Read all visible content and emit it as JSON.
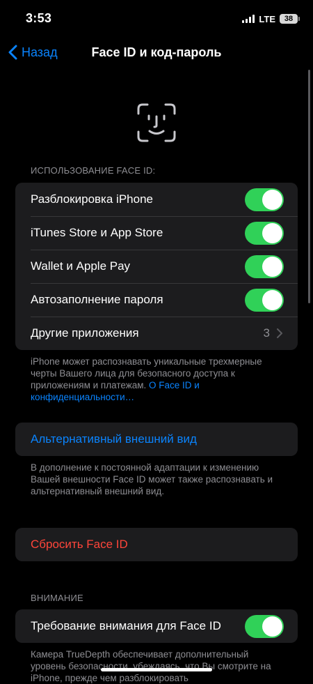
{
  "status": {
    "time": "3:53",
    "network": "LTE",
    "battery": "38"
  },
  "nav": {
    "back_label": "Назад",
    "title": "Face ID и код-пароль"
  },
  "use_faceid": {
    "header": "ИСПОЛЬЗОВАНИЕ FACE ID:",
    "items": [
      {
        "label": "Разблокировка iPhone",
        "on": true
      },
      {
        "label": "iTunes Store и App Store",
        "on": true
      },
      {
        "label": "Wallet и Apple Pay",
        "on": true
      },
      {
        "label": "Автозаполнение пароля",
        "on": true
      }
    ],
    "other_apps": {
      "label": "Другие приложения",
      "value": "3"
    },
    "footer_text": "iPhone может распознавать уникальные трехмерные черты Вашего лица для безопасного доступа к приложениям и платежам. ",
    "footer_link": "О Face ID и конфиденциальности…"
  },
  "alternate": {
    "label": "Альтернативный внешний вид",
    "footer": "В дополнение к постоянной адаптации к изменению Вашей внешности Face ID может также распознавать и альтернативный внешний вид."
  },
  "reset": {
    "label": "Сбросить Face ID"
  },
  "attention": {
    "header": "ВНИМАНИЕ",
    "item_label": "Требование внимания для Face ID",
    "item_on": true,
    "footer": "Камера TrueDepth обеспечивает дополнительный уровень безопасности, убеждаясь, что Вы смотрите на iPhone, прежде чем разблокировать"
  },
  "colors": {
    "accent": "#0a84ff",
    "toggle_on": "#30d158",
    "destructive": "#ff453a",
    "cell_bg": "#1c1c1e"
  }
}
